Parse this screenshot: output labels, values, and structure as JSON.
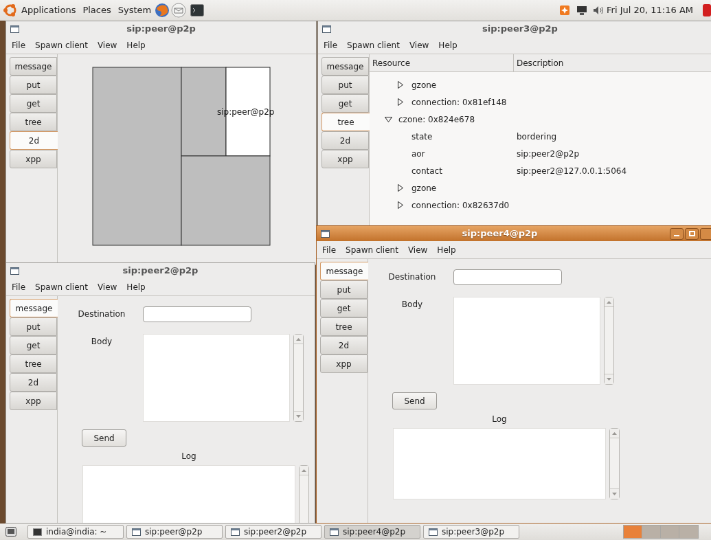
{
  "top_panel": {
    "menus": [
      "Applications",
      "Places",
      "System"
    ],
    "clock": "Fri Jul 20, 11:16 AM"
  },
  "windows": [
    {
      "title": "sip:peer@p2p",
      "active": false,
      "menu": [
        "File",
        "Spawn client",
        "View",
        "Help"
      ],
      "tabs": [
        {
          "label": "message",
          "selected": false
        },
        {
          "label": "put",
          "selected": false
        },
        {
          "label": "get",
          "selected": false
        },
        {
          "label": "tree",
          "selected": false
        },
        {
          "label": "2d",
          "selected": true
        },
        {
          "label": "xpp",
          "selected": false
        }
      ],
      "view": {
        "kind": "map",
        "label": "sip:peer@p2p"
      }
    },
    {
      "title": "sip:peer3@p2p",
      "active": false,
      "menu": [
        "File",
        "Spawn client",
        "View",
        "Help"
      ],
      "tabs": [
        {
          "label": "message",
          "selected": false
        },
        {
          "label": "put",
          "selected": false
        },
        {
          "label": "get",
          "selected": false
        },
        {
          "label": "tree",
          "selected": true
        },
        {
          "label": "2d",
          "selected": false
        },
        {
          "label": "xpp",
          "selected": false
        }
      ],
      "view": {
        "kind": "tree",
        "columns": [
          "Resource",
          "Description"
        ],
        "partial_branch": [
          {
            "resource": "gzone",
            "expanded": false
          },
          {
            "resource": "connection: 0x81ef148",
            "expanded": false
          }
        ],
        "rows": [
          {
            "resource": "czone: 0x824e678",
            "expanded": true,
            "children": [
              {
                "resource": "state",
                "description": "bordering"
              },
              {
                "resource": "aor",
                "description": "sip:peer2@p2p"
              },
              {
                "resource": "contact",
                "description": "sip:peer2@127.0.0.1:5064"
              },
              {
                "resource": "gzone",
                "expanded": false
              },
              {
                "resource": "connection: 0x82637d0",
                "expanded": false
              }
            ]
          }
        ]
      }
    },
    {
      "title": "sip:peer4@p2p",
      "active": true,
      "menu": [
        "File",
        "Spawn client",
        "View",
        "Help"
      ],
      "tabs": [
        {
          "label": "message",
          "selected": true
        },
        {
          "label": "put",
          "selected": false
        },
        {
          "label": "get",
          "selected": false
        },
        {
          "label": "tree",
          "selected": false
        },
        {
          "label": "2d",
          "selected": false
        },
        {
          "label": "xpp",
          "selected": false
        }
      ],
      "view": {
        "kind": "message",
        "destination_label": "Destination",
        "body_label": "Body",
        "send": "Send",
        "log_label": "Log"
      }
    },
    {
      "title": "sip:peer2@p2p",
      "active": false,
      "menu": [
        "File",
        "Spawn client",
        "View",
        "Help"
      ],
      "tabs": [
        {
          "label": "message",
          "selected": true
        },
        {
          "label": "put",
          "selected": false
        },
        {
          "label": "get",
          "selected": false
        },
        {
          "label": "tree",
          "selected": false
        },
        {
          "label": "2d",
          "selected": false
        },
        {
          "label": "xpp",
          "selected": false
        }
      ],
      "view": {
        "kind": "message",
        "destination_label": "Destination",
        "body_label": "Body",
        "send": "Send",
        "log_label": "Log"
      }
    }
  ],
  "taskbar": {
    "items": [
      {
        "label": "india@india: ~",
        "kind": "terminal",
        "selected": false
      },
      {
        "label": "sip:peer@p2p",
        "kind": "window",
        "selected": false
      },
      {
        "label": "sip:peer2@p2p",
        "kind": "window",
        "selected": false
      },
      {
        "label": "sip:peer4@p2p",
        "kind": "window",
        "selected": true
      },
      {
        "label": "sip:peer3@p2p",
        "kind": "window",
        "selected": false
      }
    ]
  }
}
